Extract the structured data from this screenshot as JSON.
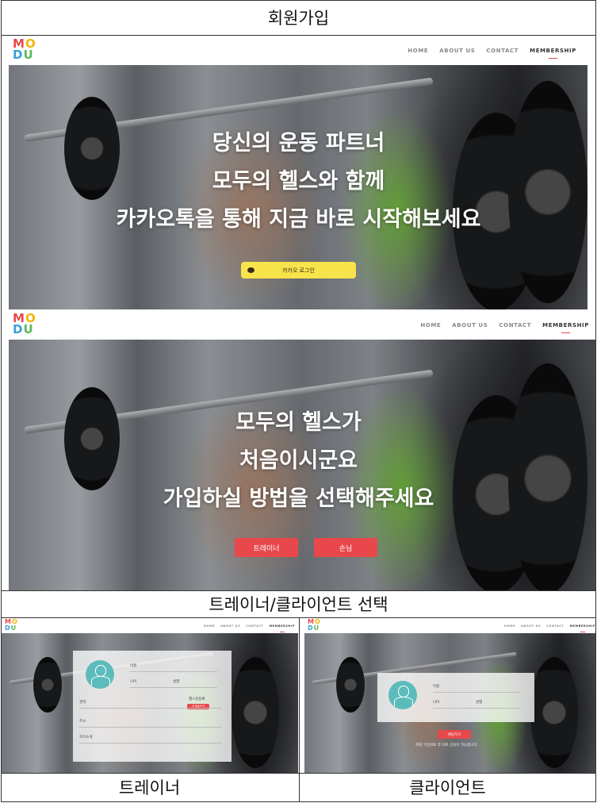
{
  "titles": {
    "top": "회원가입",
    "middle": "트레이너/클라이언트  선택",
    "bottom_left": "트레이너",
    "bottom_right": "클라이언트"
  },
  "logo": {
    "line1": [
      "M",
      "O"
    ],
    "line2": [
      "D",
      "U"
    ],
    "colors": [
      "#e8484b",
      "#f4b400",
      "#3aa0d8",
      "#5cb85c"
    ]
  },
  "nav": {
    "items": [
      "HOME",
      "ABOUT US",
      "CONTACT",
      "MEMBERSHIP"
    ],
    "active": "MEMBERSHIP"
  },
  "screen1": {
    "hero_lines": [
      "당신의 운동 파트너",
      "모두의 헬스와 함께",
      "카카오톡을 통해 지금 바로 시작해보세요"
    ],
    "kakao_button": "카카오 로그인",
    "kakao_color": "#f7e34a"
  },
  "screen2": {
    "hero_lines": [
      "모두의 헬스가",
      "처음이시군요",
      "가입하실 방법을 선택해주세요"
    ],
    "trainer_button": "트레이너",
    "guest_button": "손님",
    "button_color": "#e8484b"
  },
  "trainer_form": {
    "fields": [
      "이름",
      "나이",
      "성별",
      "경력",
      "주소",
      "자기소개"
    ],
    "side_label": "헬스장등록",
    "submit": "소개글쓰기"
  },
  "client_form": {
    "fields": [
      "이름",
      "나이",
      "성별"
    ],
    "submit": "채팅하기",
    "note": "회원 가입완료 후 바로 상담이 가능합니다"
  }
}
